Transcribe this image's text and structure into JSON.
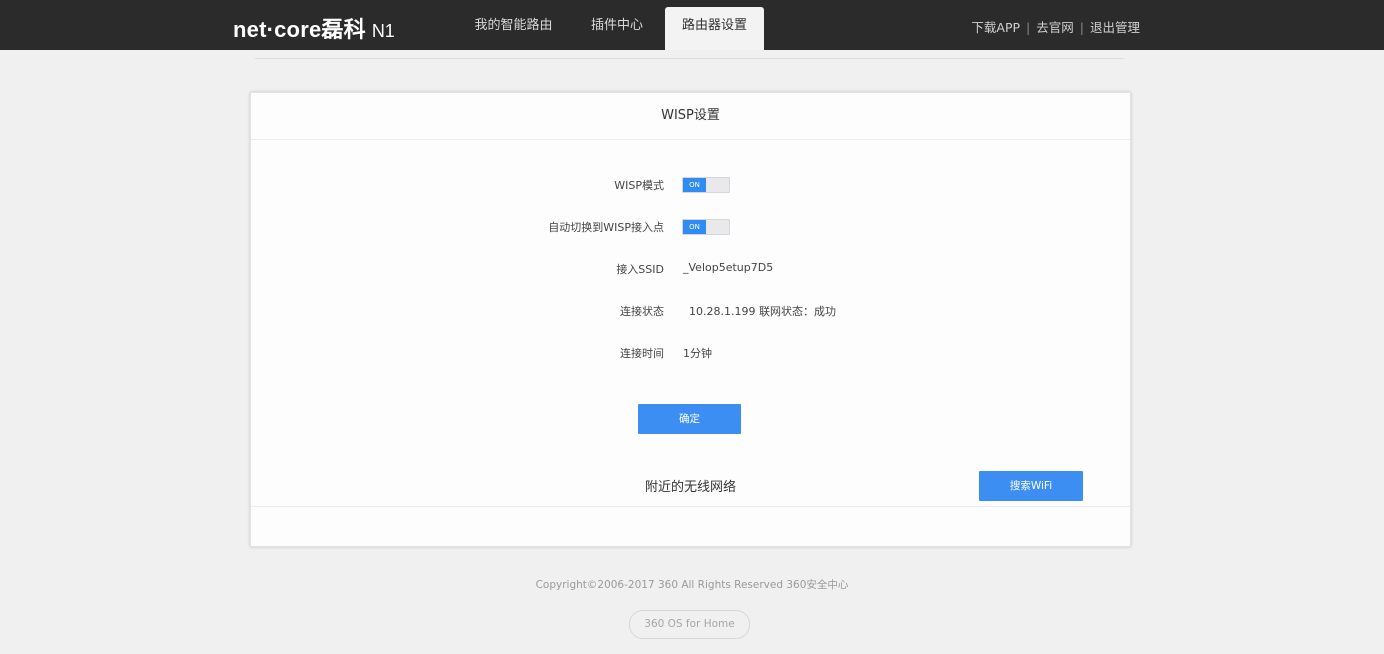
{
  "header": {
    "logo_brand": "net·core磊科",
    "logo_model": "N1",
    "tabs": [
      {
        "label": "我的智能路由"
      },
      {
        "label": "插件中心"
      },
      {
        "label": "路由器设置"
      }
    ],
    "links": [
      "下载APP",
      "去官网",
      "退出管理"
    ]
  },
  "wisp": {
    "title": "WISP设置",
    "rows": [
      {
        "label": "WISP模式",
        "toggle_label": "ON",
        "state": "on"
      },
      {
        "label": "自动切换到WISP接入点",
        "toggle_label": "ON",
        "state": "on"
      },
      {
        "label": "接入SSID",
        "value": "_Velop5etup7D5"
      },
      {
        "label": "连接状态",
        "value": "10.28.1.199  联网状态：成功"
      },
      {
        "label": "连接时间",
        "value": "1分钟"
      }
    ],
    "confirm_label": "确定",
    "nearby_title": "附近的无线网络",
    "search_label": "搜索WiFi"
  },
  "footer": {
    "copyright": "Copyright©2006-2017 360 All Rights Reserved 360安全中心",
    "badge": "360 OS for Home"
  },
  "colors": {
    "header_bg": "#2b2b2b",
    "accent": "#3d8ef3",
    "page_bg": "#f0f0f1"
  }
}
